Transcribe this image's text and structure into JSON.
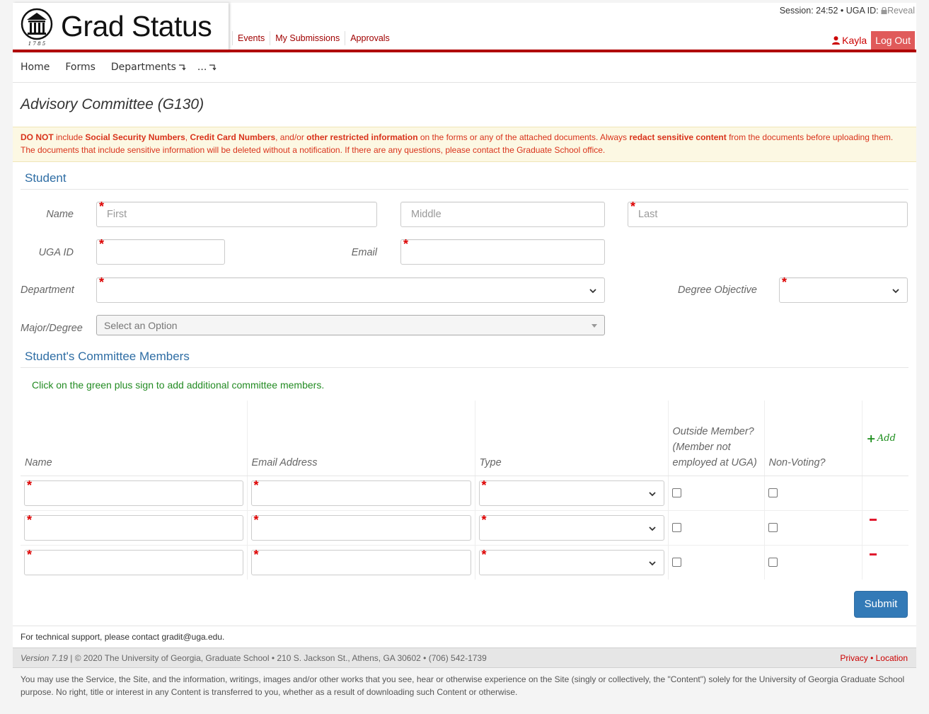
{
  "header": {
    "brand_title": "Grad Status",
    "seal_year": "1 7 8 5",
    "topnav": [
      "Events",
      "My Submissions",
      "Approvals"
    ],
    "session_label": "Session: 24:52 • UGA ID:",
    "reveal_label": "Reveal",
    "user_name": "Kayla",
    "logout_label": "Log Out"
  },
  "subnav": {
    "home": "Home",
    "forms": "Forms",
    "departments": "Departments",
    "more": "..."
  },
  "page_title": "Advisory Committee (G130)",
  "warning": {
    "p1": "DO NOT",
    "p2": " include ",
    "p3": "Social Security Numbers",
    "p4": ", ",
    "p5": "Credit Card Numbers",
    "p6": ", and/or ",
    "p7": "other restricted information",
    "p8": " on the forms or any of the attached documents. Always ",
    "p9": "redact sensitive content",
    "p10": " from the documents before uploading them. The documents that include sensitive information will be deleted without a notification. If there are any questions, please contact the Graduate School office."
  },
  "student": {
    "section_title": "Student",
    "name_label": "Name",
    "first_placeholder": "First",
    "middle_placeholder": "Middle",
    "last_placeholder": "Last",
    "ugaid_label": "UGA ID",
    "email_label": "Email",
    "department_label": "Department",
    "degree_objective_label": "Degree Objective",
    "major_label": "Major/Degree",
    "major_placeholder": "Select an Option",
    "required_mark": "*"
  },
  "committee": {
    "section_title": "Student's Committee Members",
    "hint": "Click on the green plus sign to add additional committee members.",
    "col_name": "Name",
    "col_email": "Email Address",
    "col_type": "Type",
    "col_outside": "Outside Member? (Member not employed at UGA)",
    "col_nonvoting": "Non-Voting?",
    "add_label": "Add"
  },
  "submit_label": "Submit",
  "footer": {
    "support": "For technical support, please contact gradit@uga.edu.",
    "version": "Version 7.19",
    "copyright": " | © 2020 The University of Georgia, Graduate School • 210 S. Jackson St., Athens, GA 30602 • (706) 542-1739",
    "privacy": "Privacy",
    "sep": " • ",
    "location": "Location",
    "terms": "You may use the Service, the Site, and the information, writings, images and/or other works that you see, hear or otherwise experience on the Site (singly or collectively, the \"Content\") solely for the University of Georgia Graduate School purpose. No right, title or interest in any Content is transferred to you, whether as a result of downloading such Content or otherwise."
  },
  "colors": {
    "brand_red": "#b00000",
    "link_red": "#a00000",
    "primary_blue": "#337ab7",
    "section_blue": "#2e6da4",
    "hint_green": "#228b22",
    "warning_bg": "#fcf8e3"
  }
}
